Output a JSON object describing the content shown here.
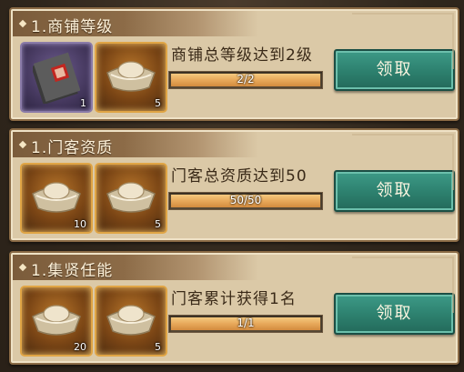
{
  "tasks": [
    {
      "title": "1.商铺等级",
      "description": "商铺总等级达到2级",
      "progress_text": "2/2",
      "progress": 1.0,
      "button": "领取",
      "rewards": [
        {
          "icon": "book-icon",
          "count": "1"
        },
        {
          "icon": "silver-ingot-icon",
          "count": "5"
        }
      ]
    },
    {
      "title": "1.门客资质",
      "description": "门客总资质达到50",
      "progress_text": "50/50",
      "progress": 1.0,
      "button": "领取",
      "rewards": [
        {
          "icon": "silver-ingot-icon",
          "count": "10"
        },
        {
          "icon": "silver-ingot-icon",
          "count": "5"
        }
      ]
    },
    {
      "title": "1.集贤任能",
      "description": "门客累计获得1名",
      "progress_text": "1/1",
      "progress": 1.0,
      "button": "领取",
      "rewards": [
        {
          "icon": "silver-ingot-icon",
          "count": "20"
        },
        {
          "icon": "silver-ingot-icon",
          "count": "5"
        }
      ]
    }
  ],
  "colors": {
    "card": "#dbc9a7",
    "button": "#2e8270",
    "progress": "#e7a85a"
  }
}
